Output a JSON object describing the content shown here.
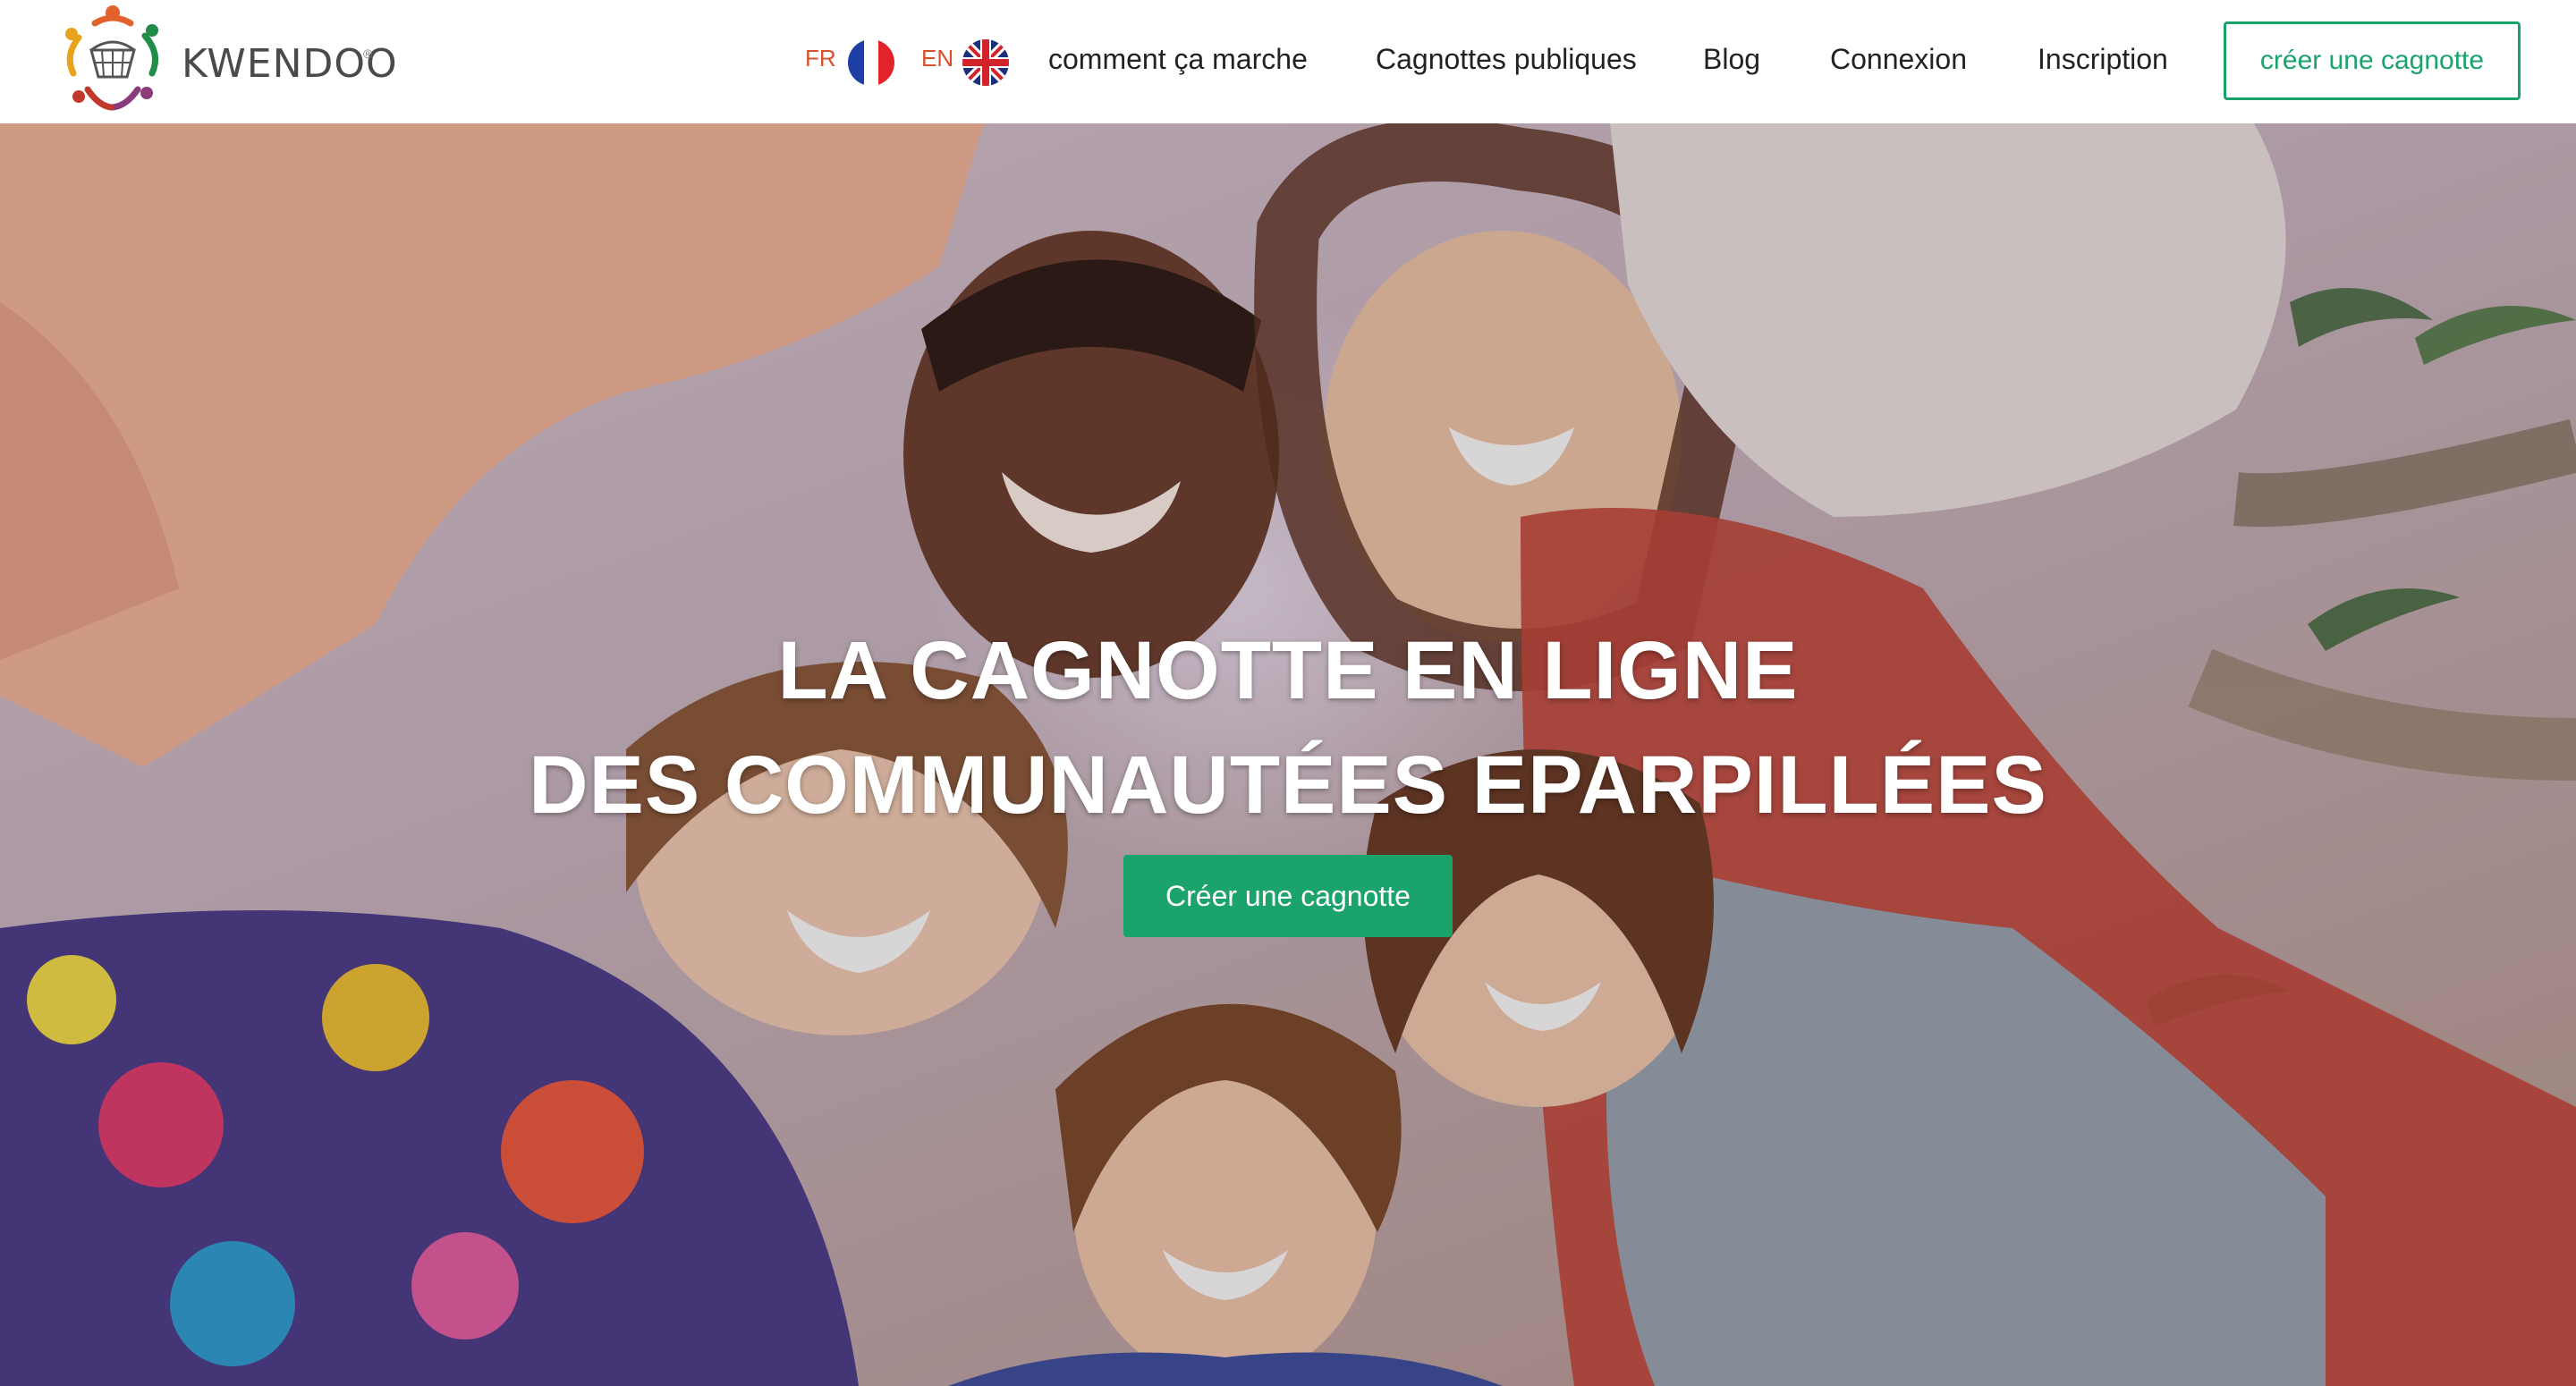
{
  "brand": {
    "name": "KWENDOO",
    "registered_mark": "®",
    "colors": {
      "accent": "#1aa36b",
      "lang": "#d9502d",
      "text": "#222222"
    }
  },
  "header": {
    "languages": [
      {
        "code": "FR",
        "flag": "france-flag-icon"
      },
      {
        "code": "EN",
        "flag": "uk-flag-icon"
      }
    ],
    "nav": {
      "how_it_works": "comment ça marche",
      "public_pots": "Cagnottes publiques",
      "blog": "Blog",
      "login": "Connexion",
      "signup": "Inscription"
    },
    "create_button": "créer une cagnotte"
  },
  "hero": {
    "headline_line1": "LA CAGNOTTE EN LIGNE",
    "headline_line2": "DES COMMUNAUTÉES EPARPILLÉES",
    "cta": "Créer une cagnotte"
  }
}
